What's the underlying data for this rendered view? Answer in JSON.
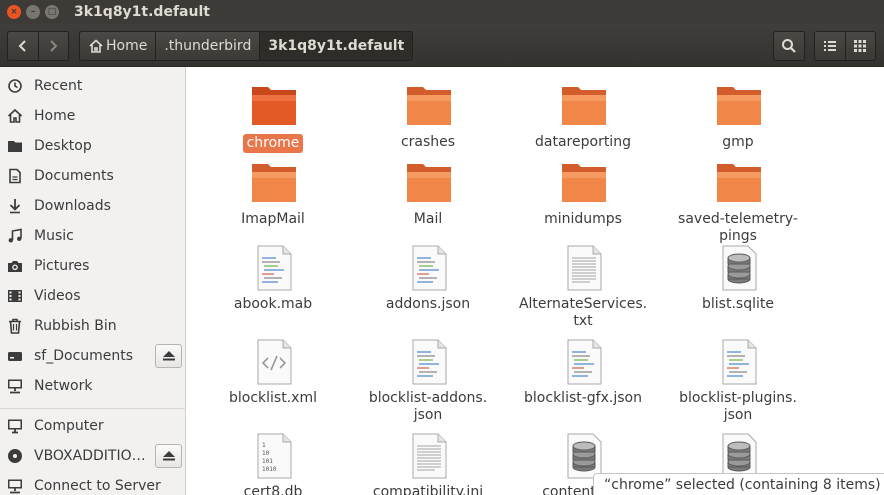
{
  "window": {
    "title": "3k1q8y1t.default",
    "close_glyph": "×",
    "min_glyph": "–",
    "max_glyph": "□"
  },
  "toolbar": {
    "breadcrumbs": [
      {
        "label": "Home",
        "icon": "home-icon"
      },
      {
        "label": ".thunderbird"
      },
      {
        "label": "3k1q8y1t.default"
      }
    ]
  },
  "sidebar": {
    "items": [
      {
        "label": "Recent",
        "icon": "clock-icon"
      },
      {
        "label": "Home",
        "icon": "home-icon"
      },
      {
        "label": "Desktop",
        "icon": "desktop-icon"
      },
      {
        "label": "Documents",
        "icon": "document-icon"
      },
      {
        "label": "Downloads",
        "icon": "download-icon"
      },
      {
        "label": "Music",
        "icon": "music-icon"
      },
      {
        "label": "Pictures",
        "icon": "camera-icon"
      },
      {
        "label": "Videos",
        "icon": "video-icon"
      },
      {
        "label": "Rubbish Bin",
        "icon": "trash-icon"
      },
      {
        "label": "sf_Documents",
        "icon": "drive-icon"
      },
      {
        "label": "Network",
        "icon": "network-icon"
      },
      {
        "label": "Computer",
        "icon": "computer-icon"
      },
      {
        "label": "VBOXADDITIO…",
        "icon": "disc-icon"
      },
      {
        "label": "Connect to Server",
        "icon": "server-icon"
      }
    ]
  },
  "files": [
    {
      "name": "chrome",
      "type": "folder",
      "selected": true
    },
    {
      "name": "crashes",
      "type": "folder"
    },
    {
      "name": "datareporting",
      "type": "folder"
    },
    {
      "name": "gmp",
      "type": "folder"
    },
    {
      "name": "ImapMail",
      "type": "folder"
    },
    {
      "name": "Mail",
      "type": "folder"
    },
    {
      "name": "minidumps",
      "type": "folder"
    },
    {
      "name": "saved-telemetry-",
      "name2": "pings",
      "type": "folder"
    },
    {
      "name": "abook.mab",
      "type": "text"
    },
    {
      "name": "addons.json",
      "type": "text"
    },
    {
      "name": "AlternateServices.",
      "name2": "txt",
      "type": "plain"
    },
    {
      "name": "blist.sqlite",
      "type": "db"
    },
    {
      "name": "blocklist.xml",
      "type": "xml"
    },
    {
      "name": "blocklist-addons.",
      "name2": "json",
      "type": "text"
    },
    {
      "name": "blocklist-gfx.json",
      "type": "text"
    },
    {
      "name": "blocklist-plugins.",
      "name2": "json",
      "type": "text"
    },
    {
      "name": "cert8.db",
      "type": "binary"
    },
    {
      "name": "compatibility.ini",
      "type": "plain"
    },
    {
      "name": "content-pre",
      "type": "db"
    },
    {
      "name": "",
      "type": "db"
    }
  ],
  "binary_glyph": "1\n10\n101\n1010",
  "status": "“chrome” selected  (containing 8 items)",
  "colors": {
    "accent": "#e95420",
    "titlebar": "#3c3b37",
    "selection": "#e9764a",
    "sidebar_bg": "#f2f1f0"
  }
}
